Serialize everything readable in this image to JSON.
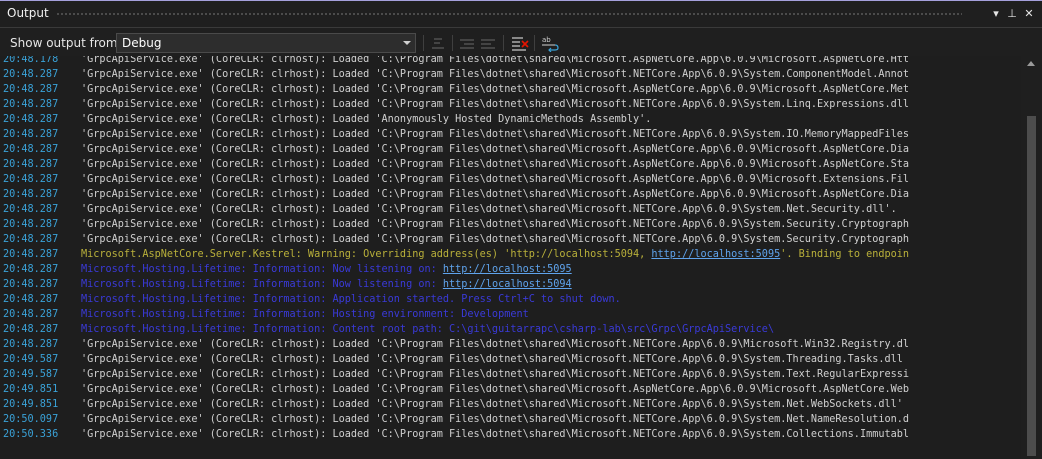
{
  "panel": {
    "title": "Output",
    "title_buttons": [
      {
        "icon": "dropdown-triangle-icon",
        "glyph": "▾"
      },
      {
        "icon": "pin-icon",
        "glyph": "⊥"
      },
      {
        "icon": "close-icon",
        "glyph": "✕"
      }
    ]
  },
  "toolbar": {
    "show_output_label": "Show output from:",
    "source_selected": "Debug",
    "buttons": [
      {
        "icon": "find-message-in-code-icon"
      },
      {
        "icon": "go-to-previous-message-icon"
      },
      {
        "icon": "go-to-next-message-icon"
      },
      {
        "icon": "clear-all-icon"
      },
      {
        "icon": "toggle-word-wrap-icon"
      }
    ]
  },
  "colors": {
    "timestamp": "#3aa2d8",
    "default": "#d0d0d0",
    "warning": "#b9b03a",
    "info": "#3a3ad8",
    "link": "#5fa3ec",
    "accent": "#a5a0dc"
  },
  "log": [
    {
      "time": "20:48.178",
      "kind": "default",
      "parts": [
        {
          "text": "'GrpcApiService.exe' (CoreCLR: clrhost): Loaded 'C:\\Program Files\\dotnet\\shared\\Microsoft.AspNetCore.App\\6.0.9\\Microsoft.AspNetCore.Htt"
        }
      ]
    },
    {
      "time": "20:48.287",
      "kind": "default",
      "parts": [
        {
          "text": "'GrpcApiService.exe' (CoreCLR: clrhost): Loaded 'C:\\Program Files\\dotnet\\shared\\Microsoft.NETCore.App\\6.0.9\\System.ComponentModel.Annot"
        }
      ]
    },
    {
      "time": "20:48.287",
      "kind": "default",
      "parts": [
        {
          "text": "'GrpcApiService.exe' (CoreCLR: clrhost): Loaded 'C:\\Program Files\\dotnet\\shared\\Microsoft.AspNetCore.App\\6.0.9\\Microsoft.AspNetCore.Met"
        }
      ]
    },
    {
      "time": "20:48.287",
      "kind": "default",
      "parts": [
        {
          "text": "'GrpcApiService.exe' (CoreCLR: clrhost): Loaded 'C:\\Program Files\\dotnet\\shared\\Microsoft.NETCore.App\\6.0.9\\System.Linq.Expressions.dll"
        }
      ]
    },
    {
      "time": "20:48.287",
      "kind": "default",
      "parts": [
        {
          "text": "'GrpcApiService.exe' (CoreCLR: clrhost): Loaded 'Anonymously Hosted DynamicMethods Assembly'."
        }
      ]
    },
    {
      "time": "20:48.287",
      "kind": "default",
      "parts": [
        {
          "text": "'GrpcApiService.exe' (CoreCLR: clrhost): Loaded 'C:\\Program Files\\dotnet\\shared\\Microsoft.NETCore.App\\6.0.9\\System.IO.MemoryMappedFiles"
        }
      ]
    },
    {
      "time": "20:48.287",
      "kind": "default",
      "parts": [
        {
          "text": "'GrpcApiService.exe' (CoreCLR: clrhost): Loaded 'C:\\Program Files\\dotnet\\shared\\Microsoft.AspNetCore.App\\6.0.9\\Microsoft.AspNetCore.Dia"
        }
      ]
    },
    {
      "time": "20:48.287",
      "kind": "default",
      "parts": [
        {
          "text": "'GrpcApiService.exe' (CoreCLR: clrhost): Loaded 'C:\\Program Files\\dotnet\\shared\\Microsoft.AspNetCore.App\\6.0.9\\Microsoft.AspNetCore.Sta"
        }
      ]
    },
    {
      "time": "20:48.287",
      "kind": "default",
      "parts": [
        {
          "text": "'GrpcApiService.exe' (CoreCLR: clrhost): Loaded 'C:\\Program Files\\dotnet\\shared\\Microsoft.AspNetCore.App\\6.0.9\\Microsoft.Extensions.Fil"
        }
      ]
    },
    {
      "time": "20:48.287",
      "kind": "default",
      "parts": [
        {
          "text": "'GrpcApiService.exe' (CoreCLR: clrhost): Loaded 'C:\\Program Files\\dotnet\\shared\\Microsoft.AspNetCore.App\\6.0.9\\Microsoft.AspNetCore.Dia"
        }
      ]
    },
    {
      "time": "20:48.287",
      "kind": "default",
      "parts": [
        {
          "text": "'GrpcApiService.exe' (CoreCLR: clrhost): Loaded 'C:\\Program Files\\dotnet\\shared\\Microsoft.NETCore.App\\6.0.9\\System.Net.Security.dll'."
        }
      ]
    },
    {
      "time": "20:48.287",
      "kind": "default",
      "parts": [
        {
          "text": "'GrpcApiService.exe' (CoreCLR: clrhost): Loaded 'C:\\Program Files\\dotnet\\shared\\Microsoft.NETCore.App\\6.0.9\\System.Security.Cryptograph"
        }
      ]
    },
    {
      "time": "20:48.287",
      "kind": "default",
      "parts": [
        {
          "text": "'GrpcApiService.exe' (CoreCLR: clrhost): Loaded 'C:\\Program Files\\dotnet\\shared\\Microsoft.NETCore.App\\6.0.9\\System.Security.Cryptograph"
        }
      ]
    },
    {
      "time": "20:48.287",
      "kind": "warning",
      "parts": [
        {
          "text": "Microsoft.AspNetCore.Server.Kestrel: Warning: Overriding address(es) 'http://localhost:5094, "
        },
        {
          "text": "http://localhost:5095",
          "link": true
        },
        {
          "text": "'. Binding to endpoin"
        }
      ]
    },
    {
      "time": "20:48.287",
      "kind": "info",
      "parts": [
        {
          "text": "Microsoft.Hosting.Lifetime: Information: Now listening on: "
        },
        {
          "text": "http://localhost:5095",
          "link": true
        }
      ]
    },
    {
      "time": "20:48.287",
      "kind": "info",
      "parts": [
        {
          "text": "Microsoft.Hosting.Lifetime: Information: Now listening on: "
        },
        {
          "text": "http://localhost:5094",
          "link": true
        }
      ]
    },
    {
      "time": "20:48.287",
      "kind": "info",
      "parts": [
        {
          "text": "Microsoft.Hosting.Lifetime: Information: Application started. Press Ctrl+C to shut down."
        }
      ]
    },
    {
      "time": "20:48.287",
      "kind": "info",
      "parts": [
        {
          "text": "Microsoft.Hosting.Lifetime: Information: Hosting environment: Development"
        }
      ]
    },
    {
      "time": "20:48.287",
      "kind": "info",
      "parts": [
        {
          "text": "Microsoft.Hosting.Lifetime: Information: Content root path: C:\\git\\guitarrapc\\csharp-lab\\src\\Grpc\\GrpcApiService\\"
        }
      ]
    },
    {
      "time": "20:48.287",
      "kind": "default",
      "parts": [
        {
          "text": "'GrpcApiService.exe' (CoreCLR: clrhost): Loaded 'C:\\Program Files\\dotnet\\shared\\Microsoft.NETCore.App\\6.0.9\\Microsoft.Win32.Registry.dl"
        }
      ]
    },
    {
      "time": "20:49.587",
      "kind": "default",
      "parts": [
        {
          "text": "'GrpcApiService.exe' (CoreCLR: clrhost): Loaded 'C:\\Program Files\\dotnet\\shared\\Microsoft.NETCore.App\\6.0.9\\System.Threading.Tasks.dll"
        }
      ]
    },
    {
      "time": "20:49.587",
      "kind": "default",
      "parts": [
        {
          "text": "'GrpcApiService.exe' (CoreCLR: clrhost): Loaded 'C:\\Program Files\\dotnet\\shared\\Microsoft.NETCore.App\\6.0.9\\System.Text.RegularExpressi"
        }
      ]
    },
    {
      "time": "20:49.851",
      "kind": "default",
      "parts": [
        {
          "text": "'GrpcApiService.exe' (CoreCLR: clrhost): Loaded 'C:\\Program Files\\dotnet\\shared\\Microsoft.AspNetCore.App\\6.0.9\\Microsoft.AspNetCore.Web"
        }
      ]
    },
    {
      "time": "20:49.851",
      "kind": "default",
      "parts": [
        {
          "text": "'GrpcApiService.exe' (CoreCLR: clrhost): Loaded 'C:\\Program Files\\dotnet\\shared\\Microsoft.NETCore.App\\6.0.9\\System.Net.WebSockets.dll'"
        }
      ]
    },
    {
      "time": "20:50.097",
      "kind": "default",
      "parts": [
        {
          "text": "'GrpcApiService.exe' (CoreCLR: clrhost): Loaded 'C:\\Program Files\\dotnet\\shared\\Microsoft.NETCore.App\\6.0.9\\System.Net.NameResolution.d"
        }
      ]
    },
    {
      "time": "20:50.336",
      "kind": "default",
      "parts": [
        {
          "text": "'GrpcApiService.exe' (CoreCLR: clrhost): Loaded 'C:\\Program Files\\dotnet\\shared\\Microsoft.NETCore.App\\6.0.9\\System.Collections.Immutabl"
        }
      ]
    }
  ]
}
